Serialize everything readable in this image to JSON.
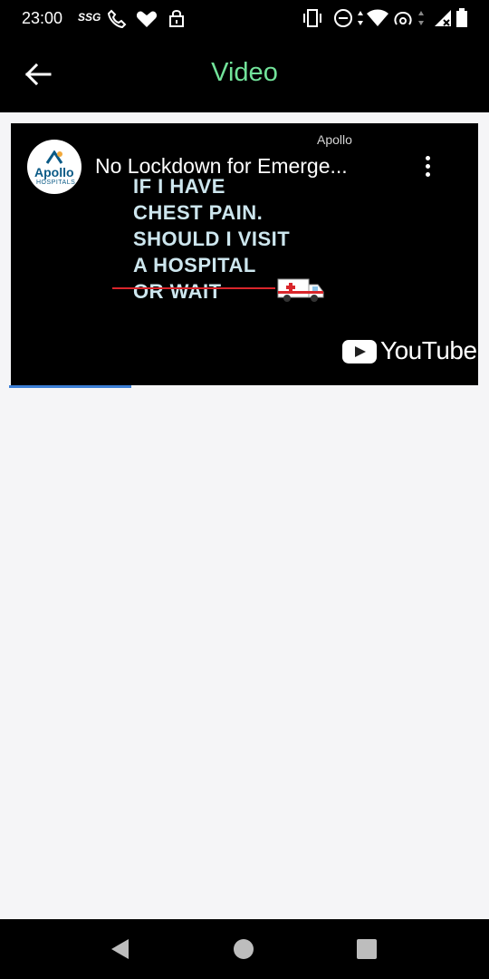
{
  "status_bar": {
    "time": "23:00",
    "carrier_tag": "SSG"
  },
  "app_bar": {
    "title": "Video",
    "title_color": "#72e39a"
  },
  "video": {
    "channel_logo_text": "Apollo",
    "channel_logo_sub": "HOSPITALS",
    "title": "No Lockdown for Emerge...",
    "watermark": "Apollo",
    "thumbnail_lines": [
      "IF I HAVE",
      "CHEST PAIN.",
      "SHOULD I VISIT",
      "A HOSPITAL",
      "OR WAIT"
    ],
    "youtube_label": "YouTube",
    "loading_progress": 0.26,
    "progress_color": "#3c7fd6"
  },
  "icons": {
    "back": "arrow-left-icon",
    "more": "more-vertical-icon",
    "nav_back": "triangle-back-icon",
    "nav_home": "circle-home-icon",
    "nav_recents": "square-recents-icon"
  }
}
